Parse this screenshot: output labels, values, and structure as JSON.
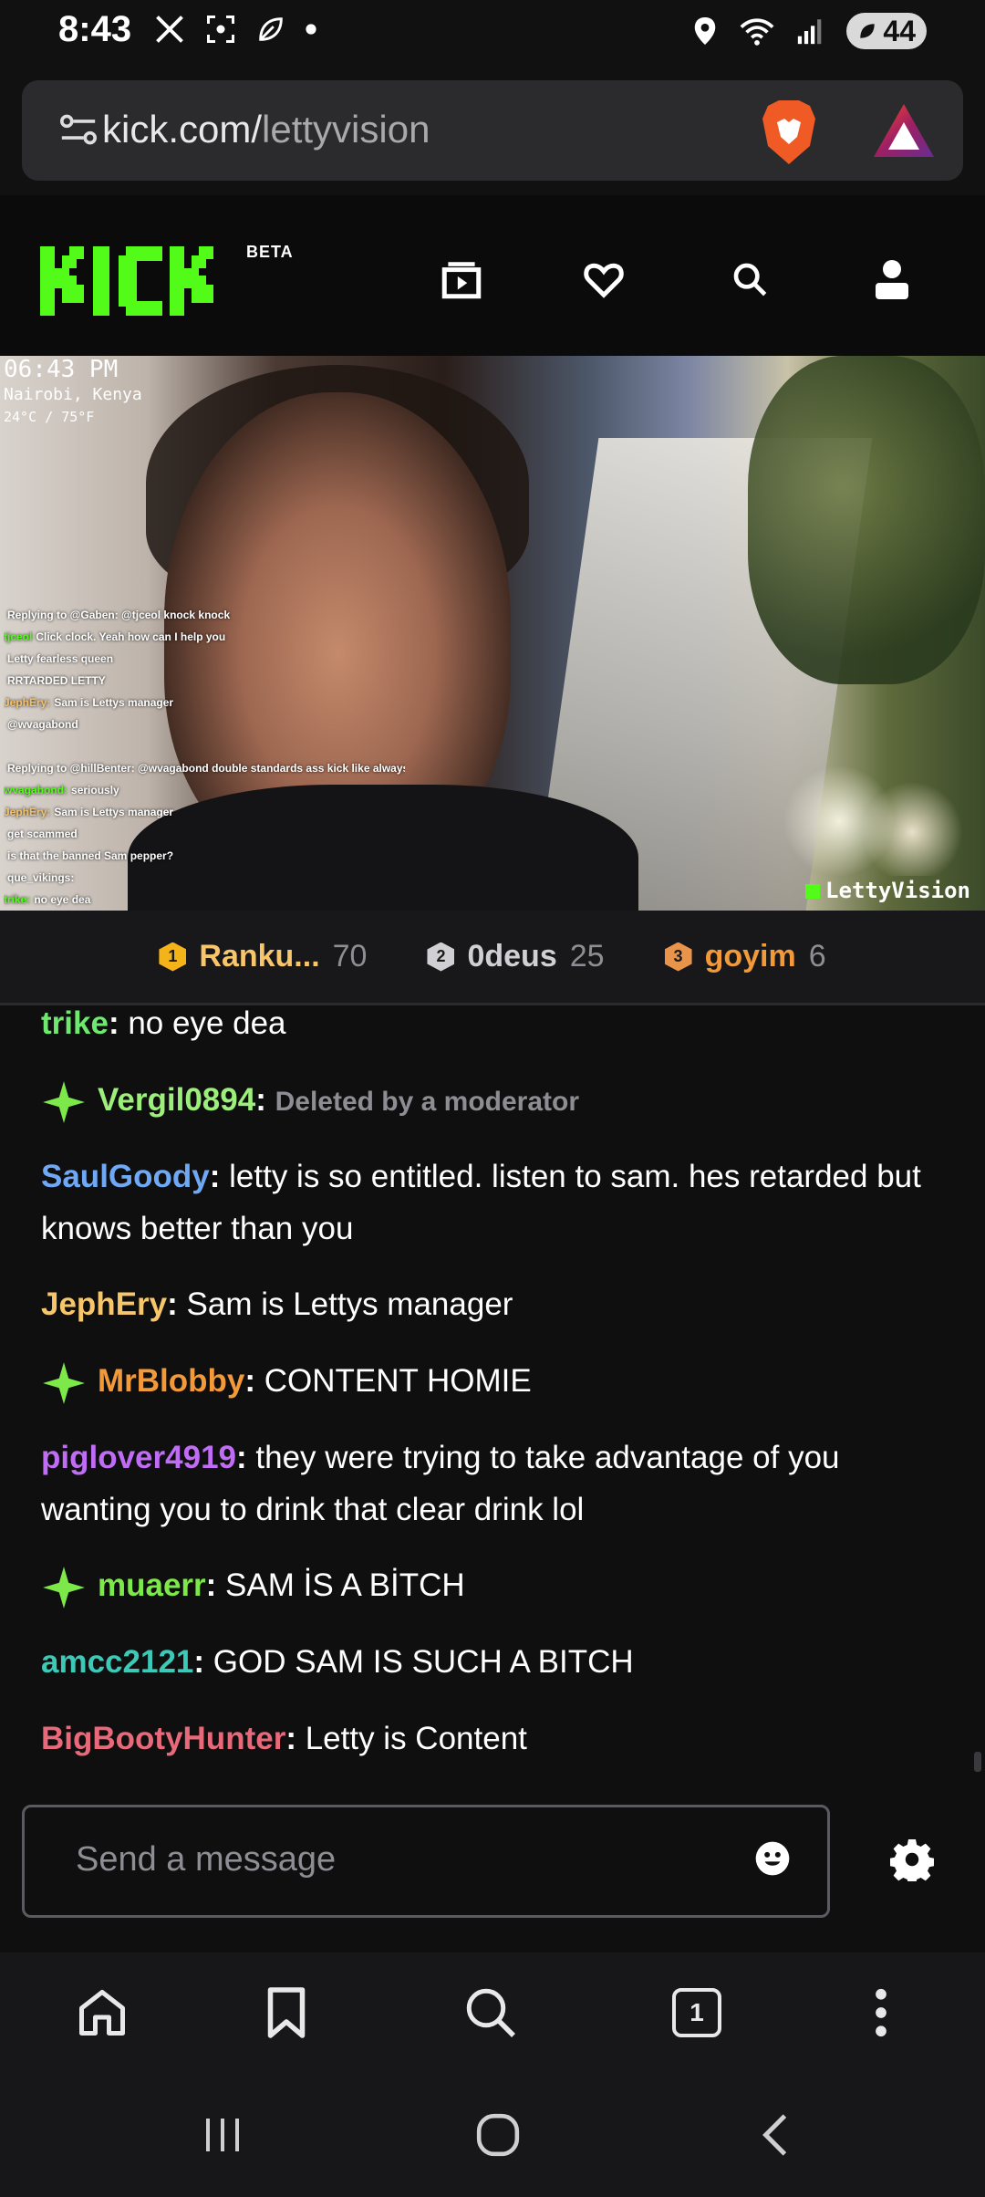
{
  "status_bar": {
    "time": "8:43",
    "battery": "44",
    "left_icons": [
      "x-icon",
      "screenshot-icon",
      "leaf-icon",
      "dot-icon"
    ],
    "right_icons": [
      "location-icon",
      "wifi-icon",
      "signal-icon",
      "battery-icon"
    ]
  },
  "browser": {
    "url_domain": "kick.com/",
    "url_path": "lettyvision",
    "tab_count": "1"
  },
  "kick": {
    "beta_label": "BETA",
    "brand_color": "#53fc18"
  },
  "video": {
    "overlay_time": "06:43 PM",
    "overlay_location": "Nairobi, Kenya",
    "overlay_temp": "24°C / 75°F",
    "watermark": "LettyVision",
    "overlay_chat": [
      {
        "user": "",
        "text": "Replying to @Gaben: @tjceol knock knock",
        "color": "#ffffff"
      },
      {
        "user": "tjceol",
        "text": "Click clock. Yeah how can I help you",
        "color": "#53fc18"
      },
      {
        "user": "",
        "text": "Letty fearless queen",
        "color": "#b16cf5"
      },
      {
        "user": "",
        "text": "RRTARDED LETTY",
        "color": "#4fb6e8"
      },
      {
        "user": "JephEry:",
        "text": "Sam is Lettys manager",
        "color": "#f5c26b"
      },
      {
        "user": "",
        "text": "@wvagabond",
        "color": "#b16cf5"
      },
      {
        "user": "",
        "text": "",
        "color": "#f2993a"
      },
      {
        "user": "",
        "text": "Replying to @hillBenter: @wvagabond double standards ass kick like always",
        "color": "#ffffff"
      },
      {
        "user": "wvagabond:",
        "text": "seriously",
        "color": "#53fc18"
      },
      {
        "user": "JephEry:",
        "text": "Sam is Lettys manager",
        "color": "#f5c26b"
      },
      {
        "user": "",
        "text": "get scammed",
        "color": "#4fb6e8"
      },
      {
        "user": "",
        "text": "is that the banned Sam pepper?",
        "color": "#e8475f"
      },
      {
        "user": "",
        "text": "que_vikings:",
        "color": "#b16cf5"
      },
      {
        "user": "trike:",
        "text": "no eye dea",
        "color": "#53fc18"
      }
    ]
  },
  "leaderboard": [
    {
      "rank": "1",
      "name": "Ranku...",
      "count": "70",
      "badge_color": "#f5b31a",
      "name_color": "#f7c66a"
    },
    {
      "rank": "2",
      "name": "0deus",
      "count": "25",
      "badge_color": "#d0d0d4",
      "name_color": "#d0d0d4"
    },
    {
      "rank": "3",
      "name": "goyim",
      "count": "6",
      "badge_color": "#e8944a",
      "name_color": "#f2993a"
    }
  ],
  "chat": {
    "messages": [
      {
        "user": "trike",
        "text": " no eye dea",
        "color": "#6ee86e",
        "badge": false
      },
      {
        "user": "Vergil0894",
        "text": "Deleted by a moderator",
        "color": "#9cef7a",
        "badge": true,
        "deleted": true
      },
      {
        "user": "SaulGoody",
        "text": " letty is so entitled. listen to sam. hes retarded but knows better than you",
        "color": "#6fa8f5",
        "badge": false
      },
      {
        "user": "JephEry",
        "text": " Sam is Lettys manager",
        "color": "#f7c66a",
        "badge": false
      },
      {
        "user": "MrBlobby",
        "text": " CONTENT HOMIE",
        "color": "#f2993a",
        "badge": true
      },
      {
        "user": "piglover4919",
        "text": " they were trying to take advantage of you wanting you to drink that clear drink lol",
        "color": "#c16cf5",
        "badge": false
      },
      {
        "user": "muaerr",
        "text": " SAM İS A BİTCH",
        "color": "#7de84a",
        "badge": true
      },
      {
        "user": "amcc2121",
        "text": " GOD SAM IS SUCH A BITCH",
        "color": "#3cc9b8",
        "badge": false
      },
      {
        "user": "BigBootyHunter",
        "text": " Letty is Content",
        "color": "#e8697a",
        "badge": false
      }
    ],
    "input_placeholder": "Send a message"
  }
}
